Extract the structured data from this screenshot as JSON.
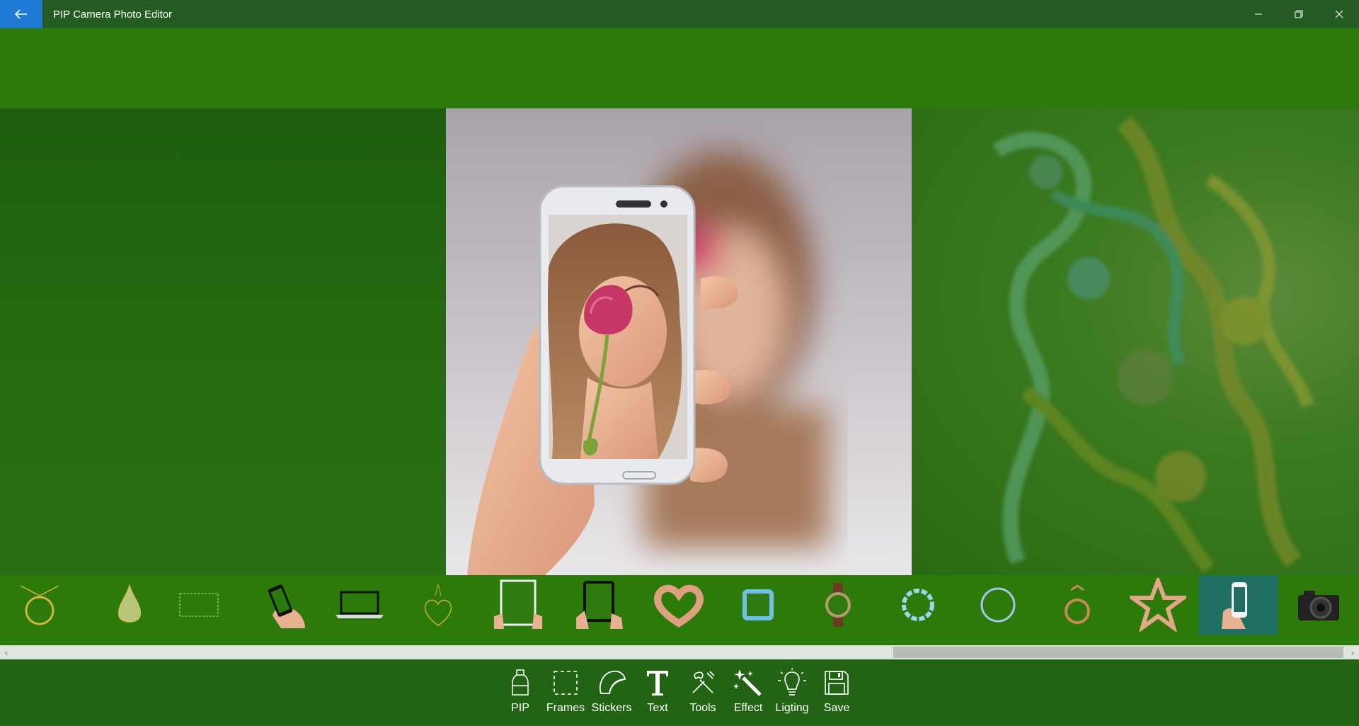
{
  "window": {
    "title": "PIP Camera Photo Editor"
  },
  "thumbnails": [
    {
      "name": "pendant-ring-frame",
      "selected": false
    },
    {
      "name": "water-drop-frame",
      "selected": false
    },
    {
      "name": "dashed-rectangle-frame",
      "selected": false
    },
    {
      "name": "hand-phone-black-frame",
      "selected": false
    },
    {
      "name": "laptop-frame",
      "selected": false
    },
    {
      "name": "heart-pendant-frame",
      "selected": false
    },
    {
      "name": "hands-tablet-white-frame",
      "selected": false
    },
    {
      "name": "hands-tablet-black-frame",
      "selected": false
    },
    {
      "name": "heart-hands-frame",
      "selected": false
    },
    {
      "name": "ice-cube-frame",
      "selected": false
    },
    {
      "name": "wristwatch-frame",
      "selected": false
    },
    {
      "name": "water-splash-ring-frame",
      "selected": false
    },
    {
      "name": "blue-ring-frame",
      "selected": false
    },
    {
      "name": "ring-frame",
      "selected": false
    },
    {
      "name": "star-hands-frame",
      "selected": false
    },
    {
      "name": "hand-phone-white-frame",
      "selected": true
    },
    {
      "name": "camera-frame",
      "selected": false
    }
  ],
  "toolbar": {
    "items": [
      {
        "label": "PIP",
        "icon": "bottle-icon"
      },
      {
        "label": "Frames",
        "icon": "dashed-square-icon"
      },
      {
        "label": "Stickers",
        "icon": "sticker-icon"
      },
      {
        "label": "Text",
        "icon": "text-icon"
      },
      {
        "label": "Tools",
        "icon": "tools-icon"
      },
      {
        "label": "Effect",
        "icon": "magic-wand-icon"
      },
      {
        "label": "Ligting",
        "icon": "lightbulb-icon"
      },
      {
        "label": "Save",
        "icon": "floppy-disk-icon"
      }
    ]
  },
  "colors": {
    "titlebar": "#245b22",
    "back_button": "#1f7ad6",
    "top_band": "#2b790a",
    "strip": "#2b7a0a",
    "selected_thumb": "#1f7060",
    "toolbar": "#236314"
  }
}
